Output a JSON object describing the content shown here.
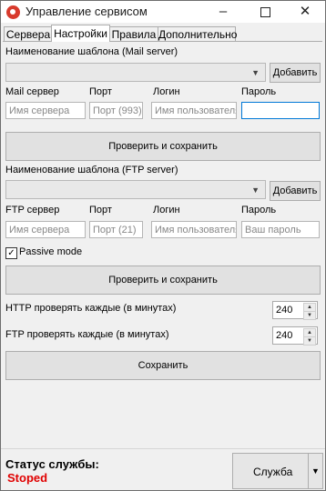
{
  "window": {
    "title": "Управление сервисом",
    "minimize": "–",
    "close": "✕"
  },
  "tabs": [
    "Сервера",
    "Настройки",
    "Правила",
    "Дополнительно"
  ],
  "mail": {
    "template_label": "Наименование шаблона (Mail server)",
    "add_button": "Добавить",
    "server_label": "Mail сервер",
    "port_label": "Порт",
    "login_label": "Логин",
    "password_label": "Пароль",
    "server_placeholder": "Имя сервера",
    "port_placeholder": "Порт (993)",
    "login_placeholder": "Имя пользователя",
    "password_value": "",
    "check_save_button": "Проверить и сохранить"
  },
  "ftp": {
    "template_label": "Наименование шаблона (FTP server)",
    "add_button": "Добавить",
    "server_label": "FTP сервер",
    "port_label": "Порт",
    "login_label": "Логин",
    "password_label": "Пароль",
    "server_placeholder": "Имя сервера",
    "port_placeholder": "Порт (21)",
    "login_placeholder": "Имя пользователя",
    "password_placeholder": "Ваш пароль",
    "passive_mode_label": "Passive mode",
    "passive_mode_checked": true,
    "check_save_button": "Проверить и сохранить"
  },
  "intervals": {
    "http_label": "HTTP проверять каждые (в минутах)",
    "http_value": "240",
    "ftp_label": "FTP проверять каждые (в минутах)",
    "ftp_value": "240"
  },
  "save_button": "Сохранить",
  "status": {
    "label": "Статус службы:",
    "value": "Stoped",
    "service_button": "Служба"
  },
  "colors": {
    "status_stopped": "#e00000",
    "focus_border": "#0078d7"
  }
}
